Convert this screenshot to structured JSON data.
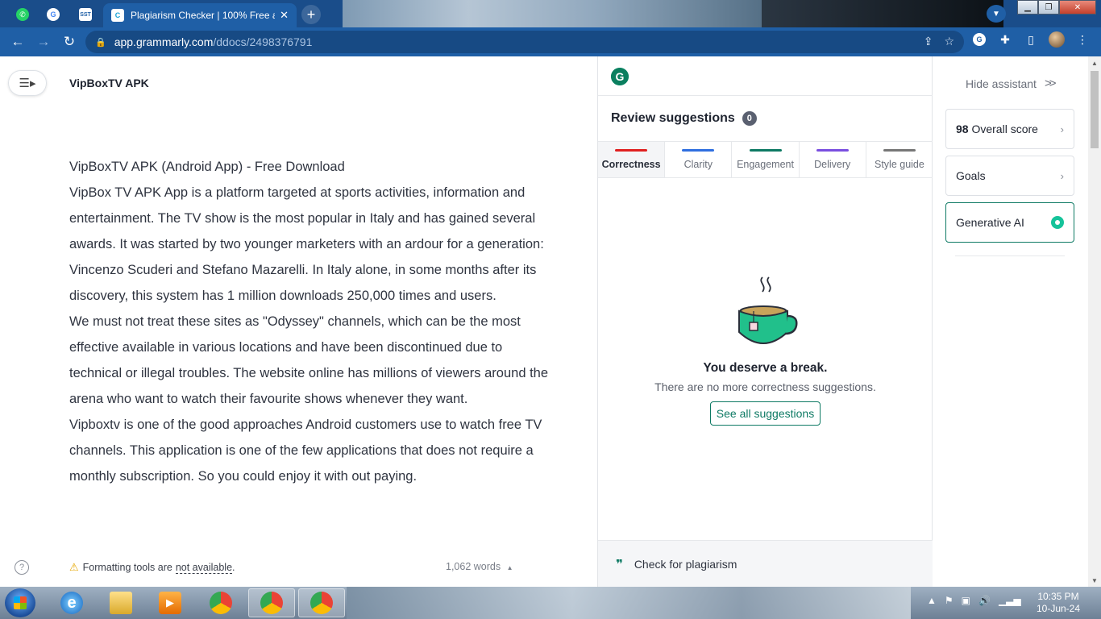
{
  "browser": {
    "active_tab_title": "Plagiarism Checker | 100% Free a",
    "url_host": "app.grammarly.com",
    "url_path": "/ddocs/2498376791"
  },
  "editor": {
    "doc_title": "VipBoxTV APK",
    "paragraphs": [
      "VipBoxTV APK (Android App) - Free Download",
      "VipBox TV APK App is a platform targeted at sports activities, information and entertainment. The TV show is the most popular in Italy and has gained several awards. It was started by two younger marketers with an ardour for a generation: Vincenzo Scuderi and Stefano Mazarelli. In Italy alone, in some months after its discovery, this system has 1 million downloads 250,000 times and users.",
      "We must not treat these sites as \"Odyssey\" channels, which can be the most effective available in various locations and have been discontinued due to technical or illegal troubles. The website online has millions of viewers around the arena who want to watch their favourite shows whenever they want.",
      "Vipboxtv is one of the good approaches Android customers use to watch free TV channels. This application is one of the few applications that does not require a monthly subscription. So you could enjoy it with out paying."
    ],
    "format_note_prefix": "Formatting tools are",
    "format_note_link": "not available",
    "format_note_suffix": ".",
    "word_count": "1,062 words"
  },
  "assistant": {
    "review_title": "Review suggestions",
    "suggestion_count": "0",
    "tabs": [
      {
        "label": "Correctness",
        "color": "#e02020",
        "active": true
      },
      {
        "label": "Clarity",
        "color": "#2f6fe0"
      },
      {
        "label": "Engagement",
        "color": "#0e7a64"
      },
      {
        "label": "Delivery",
        "color": "#7a4fe0"
      },
      {
        "label": "Style guide",
        "color": "#777777"
      }
    ],
    "empty_title": "You deserve a break.",
    "empty_sub": "There are no more correctness suggestions.",
    "see_all": "See all suggestions",
    "plagiarism": "Check for plagiarism"
  },
  "side": {
    "hide_assistant": "Hide assistant",
    "score_value": "98",
    "score_label": "Overall score",
    "goals": "Goals",
    "generative_ai": "Generative AI"
  },
  "taskbar": {
    "time": "10:35 PM",
    "date": "10-Jun-24"
  },
  "colors": {
    "brand": "#15c39a",
    "accent": "#0e7a64",
    "chrome": "#1f5fa6"
  }
}
